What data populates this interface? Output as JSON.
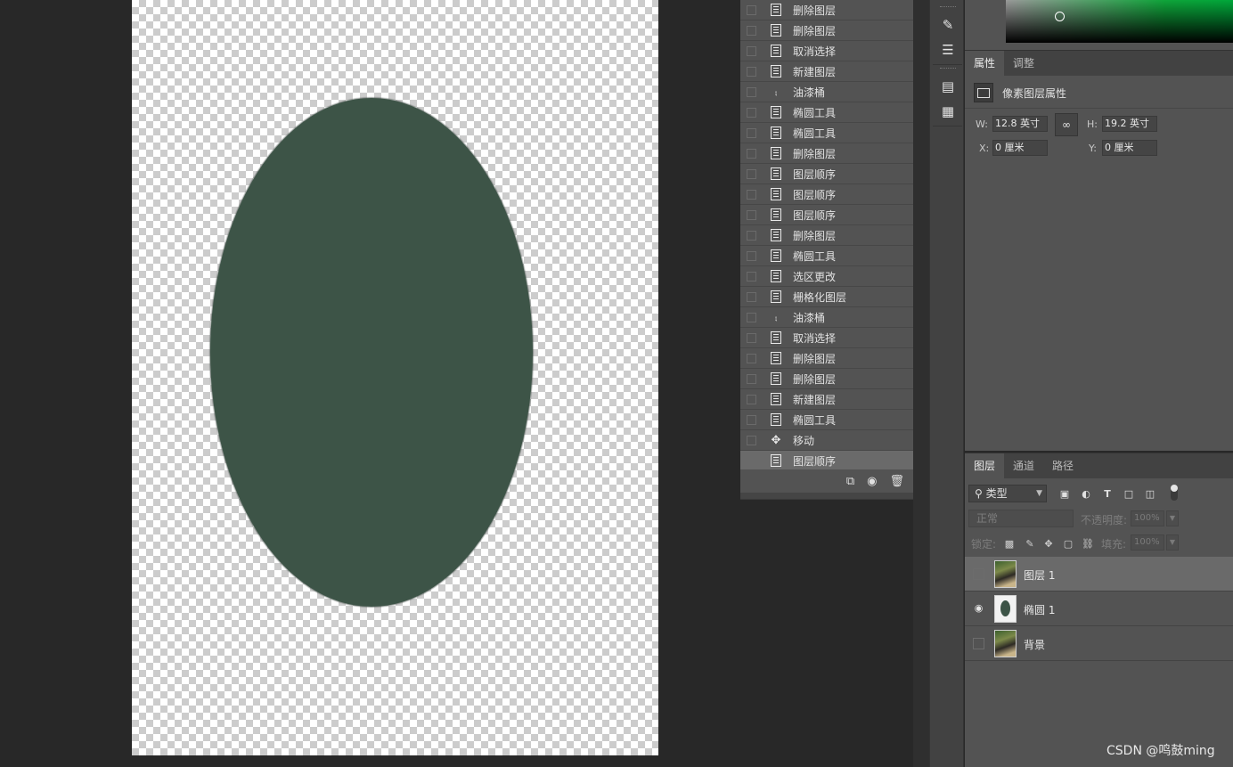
{
  "history": {
    "items": [
      {
        "label": "删除图层",
        "icon": "document-icon"
      },
      {
        "label": "删除图层",
        "icon": "document-icon"
      },
      {
        "label": "取消选择",
        "icon": "document-icon"
      },
      {
        "label": "新建图层",
        "icon": "document-icon"
      },
      {
        "label": "油漆桶",
        "icon": "paint-bucket-icon"
      },
      {
        "label": "椭圆工具",
        "icon": "document-icon"
      },
      {
        "label": "椭圆工具",
        "icon": "document-icon"
      },
      {
        "label": "删除图层",
        "icon": "document-icon"
      },
      {
        "label": "图层顺序",
        "icon": "document-icon"
      },
      {
        "label": "图层顺序",
        "icon": "document-icon"
      },
      {
        "label": "图层顺序",
        "icon": "document-icon"
      },
      {
        "label": "删除图层",
        "icon": "document-icon"
      },
      {
        "label": "椭圆工具",
        "icon": "document-icon"
      },
      {
        "label": "选区更改",
        "icon": "document-icon"
      },
      {
        "label": "栅格化图层",
        "icon": "document-icon"
      },
      {
        "label": "油漆桶",
        "icon": "paint-bucket-icon"
      },
      {
        "label": "取消选择",
        "icon": "document-icon"
      },
      {
        "label": "删除图层",
        "icon": "document-icon"
      },
      {
        "label": "删除图层",
        "icon": "document-icon"
      },
      {
        "label": "新建图层",
        "icon": "document-icon"
      },
      {
        "label": "椭圆工具",
        "icon": "document-icon"
      },
      {
        "label": "移动",
        "icon": "move-icon"
      },
      {
        "label": "图层顺序",
        "icon": "document-icon",
        "active": true
      }
    ]
  },
  "properties": {
    "tabs": [
      "属性",
      "调整"
    ],
    "header": "像素图层属性",
    "w_label": "W:",
    "w_value": "12.8 英寸",
    "h_label": "H:",
    "h_value": "19.2 英寸",
    "x_label": "X:",
    "x_value": "0 厘米",
    "y_label": "Y:",
    "y_value": "0 厘米"
  },
  "layers": {
    "tabs": [
      "图层",
      "通道",
      "路径"
    ],
    "filter": "类型",
    "blend_mode": "正常",
    "opacity_label": "不透明度:",
    "opacity_value": "100%",
    "lock_label": "锁定:",
    "fill_label": "填充:",
    "fill_value": "100%",
    "rows": [
      {
        "name": "图层 1",
        "visible": false,
        "active": true
      },
      {
        "name": "椭圆 1",
        "visible": true,
        "active": false
      },
      {
        "name": "背景",
        "visible": false,
        "active": false
      }
    ]
  },
  "canvas": {
    "shape_color": "#3d5447"
  },
  "watermark": "CSDN @鸣鼓ming"
}
